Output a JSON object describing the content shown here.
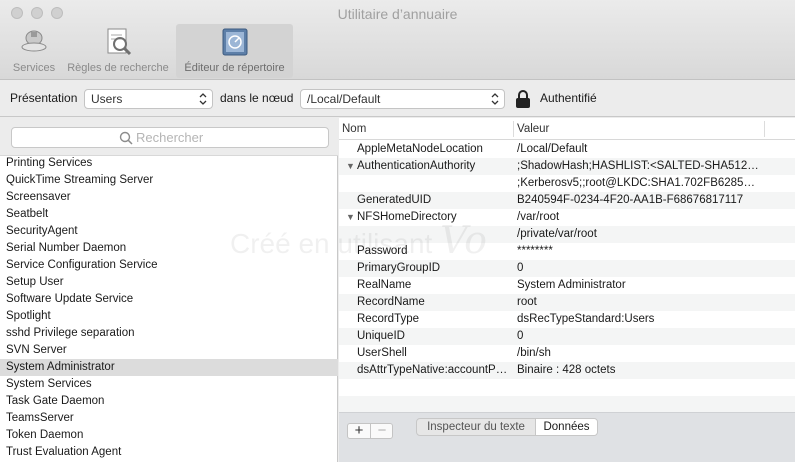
{
  "window": {
    "title": "Utilitaire d’annuaire"
  },
  "toolbar": {
    "items": [
      {
        "label": "Services",
        "icon": "services-icon"
      },
      {
        "label": "Règles de recherche",
        "icon": "search-rules-icon"
      },
      {
        "label": "Éditeur de répertoire",
        "icon": "directory-editor-icon",
        "active": true
      }
    ]
  },
  "presentation": {
    "label": "Présentation",
    "type_value": "Users",
    "node_label": "dans le nœud",
    "node_value": "/Local/Default",
    "auth_status": "Authentifié"
  },
  "search": {
    "placeholder": "Rechercher"
  },
  "records": [
    "Printing Services",
    "QuickTime Streaming Server",
    "Screensaver",
    "Seatbelt",
    "SecurityAgent",
    "Serial Number Daemon",
    "Service Configuration Service",
    "Setup User",
    "Software Update Service",
    "Spotlight",
    "sshd Privilege separation",
    "SVN Server",
    "System Administrator",
    "System Services",
    "Task Gate Daemon",
    "TeamsServer",
    "Token Daemon",
    "Trust Evaluation Agent"
  ],
  "selected_record": "System Administrator",
  "table": {
    "col_name": "Nom",
    "col_value": "Valeur",
    "rows": [
      {
        "name": "AppleMetaNodeLocation",
        "value": "/Local/Default"
      },
      {
        "name": "AuthenticationAuthority",
        "value": ";ShadowHash;HASHLIST:<SALTED-SHA512-…",
        "expanded": true
      },
      {
        "name": "",
        "value": ";Kerberosv5;;root@LKDC:SHA1.702FB62857…"
      },
      {
        "name": "GeneratedUID",
        "value": "B240594F-0234-4F20-AA1B-F68676817117"
      },
      {
        "name": "NFSHomeDirectory",
        "value": "/var/root",
        "expanded": true
      },
      {
        "name": "",
        "value": "/private/var/root"
      },
      {
        "name": "Password",
        "value": "********"
      },
      {
        "name": "PrimaryGroupID",
        "value": "0"
      },
      {
        "name": "RealName",
        "value": "System Administrator"
      },
      {
        "name": "RecordName",
        "value": "root"
      },
      {
        "name": "RecordType",
        "value": "dsRecTypeStandard:Users"
      },
      {
        "name": "UniqueID",
        "value": "0"
      },
      {
        "name": "UserShell",
        "value": "/bin/sh"
      },
      {
        "name": "dsAttrTypeNative:accountP…",
        "value": "Binaire : 428 octets"
      }
    ]
  },
  "bottom": {
    "add": "+",
    "remove": "−",
    "text_inspector": "Inspecteur du texte",
    "data": "Données"
  },
  "watermark": {
    "text": "Créé en utilisant",
    "brand": "Vo"
  }
}
